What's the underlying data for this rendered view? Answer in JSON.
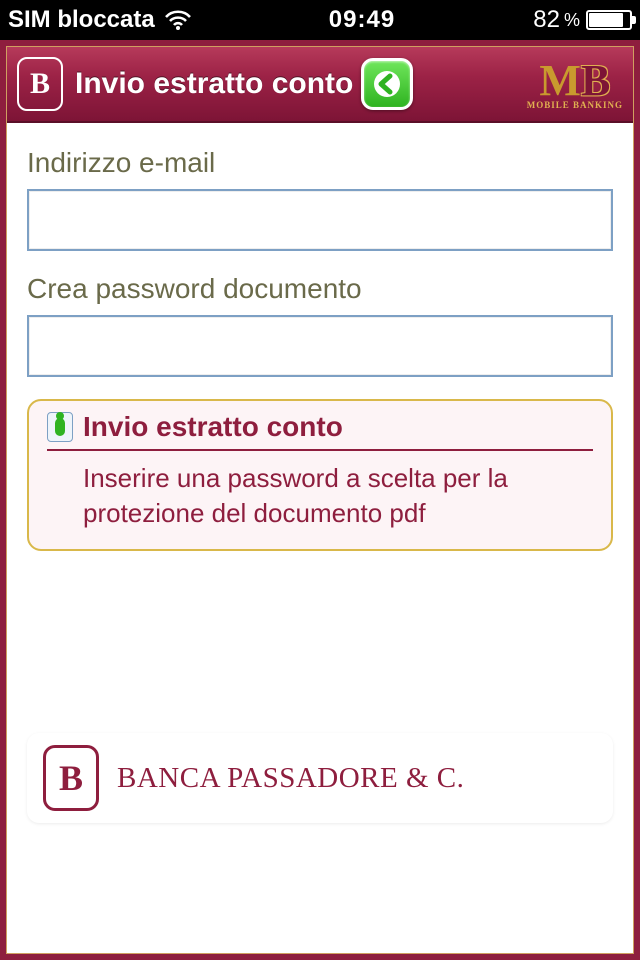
{
  "status": {
    "carrier": "SIM bloccata",
    "time": "09:49",
    "battery_pct": "82",
    "pct_sign": "%"
  },
  "header": {
    "title": "Invio estratto conto",
    "mb_m": "M",
    "mb_b": "B",
    "mb_sub": "MOBILE BANKING",
    "bp_glyph": "B"
  },
  "form": {
    "email_label": "Indirizzo e-mail",
    "email_value": "",
    "password_label": "Crea password documento",
    "password_value": ""
  },
  "info": {
    "title": "Invio estratto conto",
    "text": "Inserire una password a scelta per la protezione del documento pdf"
  },
  "footer": {
    "bank_glyph": "B",
    "bank_name": "BANCA PASSADORE & C."
  }
}
